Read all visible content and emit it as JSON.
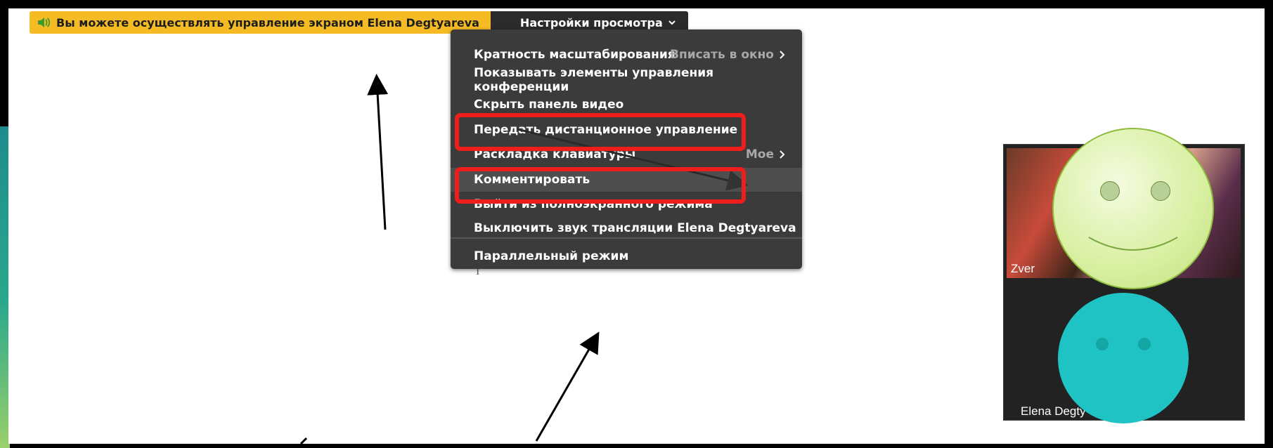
{
  "topbar": {
    "share_text": "Вы можете осуществлять управление экраном Elena Degtyareva",
    "view_settings_label": "Настройки просмотра"
  },
  "menu": {
    "items": [
      {
        "label": "Кратность масштабирования",
        "sub": "Вписать в окно"
      },
      {
        "label": "Показывать элементы управления конференции"
      },
      {
        "label": "Скрыть панель видео"
      },
      {
        "label": "Передать дистанционное управление"
      },
      {
        "label": "Раскладка клавиатуры",
        "sub": "Мое"
      },
      {
        "label": "Комментировать"
      },
      {
        "label": "Выйти из полноэкранного режима"
      },
      {
        "label": "Выключить звук трансляции Elena Degtyareva"
      },
      {
        "label": "Параллельный режим"
      }
    ]
  },
  "video": {
    "tile1_name": "Zver",
    "tile2_name": "Elena Degty"
  },
  "colors": {
    "banner": "#f5bb24",
    "menu_bg": "#3b3b3b",
    "highlight_box": "#f01d1d"
  }
}
